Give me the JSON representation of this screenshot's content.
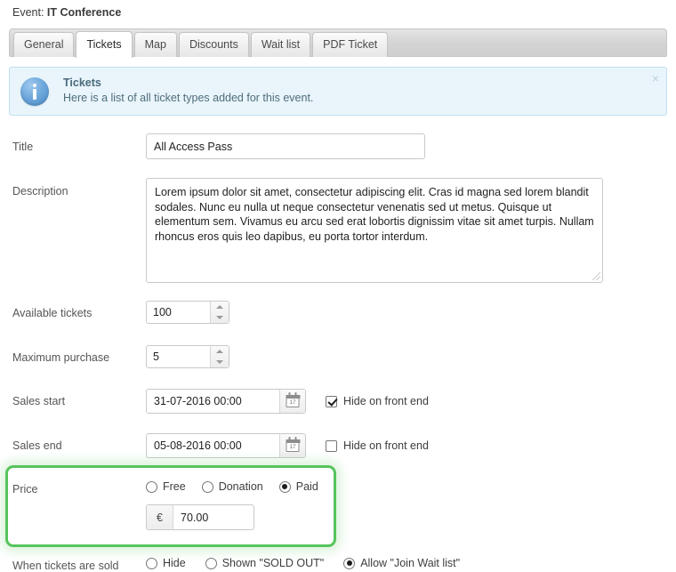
{
  "header": {
    "event_prefix": "Event:",
    "event_name": "IT Conference"
  },
  "tabs": [
    {
      "label": "General",
      "active": false
    },
    {
      "label": "Tickets",
      "active": true
    },
    {
      "label": "Map",
      "active": false
    },
    {
      "label": "Discounts",
      "active": false
    },
    {
      "label": "Wait list",
      "active": false
    },
    {
      "label": "PDF Ticket",
      "active": false
    }
  ],
  "info": {
    "icon": "info-circle-icon",
    "title": "Tickets",
    "text": "Here is a list of all ticket types added for this event.",
    "close_label": "×"
  },
  "form": {
    "title": {
      "label": "Title",
      "value": "All Access Pass",
      "placeholder": ""
    },
    "description": {
      "label": "Description",
      "value": "Lorem ipsum dolor sit amet, consectetur adipiscing elit. Cras id magna sed lorem blandit sodales. Nunc eu nulla ut neque consectetur venenatis sed ut metus. Quisque ut elementum sem. Vivamus eu arcu sed erat lobortis dignissim vitae sit amet turpis. Nullam rhoncus eros quis leo dapibus, eu porta tortor interdum.",
      "placeholder": ""
    },
    "available_tickets": {
      "label": "Available tickets",
      "value": "100"
    },
    "maximum_purchase": {
      "label": "Maximum purchase",
      "value": "5"
    },
    "sales_start": {
      "label": "Sales start",
      "value": "31-07-2016 00:00",
      "calendar_day": "17",
      "hide_label": "Hide on front end",
      "hide_checked": true
    },
    "sales_end": {
      "label": "Sales end",
      "value": "05-08-2016 00:00",
      "calendar_day": "17",
      "hide_label": "Hide on front end",
      "hide_checked": false
    },
    "price": {
      "label": "Price",
      "options": [
        {
          "label": "Free",
          "selected": false
        },
        {
          "label": "Donation",
          "selected": false
        },
        {
          "label": "Paid",
          "selected": true
        }
      ],
      "currency_symbol": "€",
      "amount": "70.00",
      "highlight_color": "#56c45c"
    },
    "when_sold": {
      "label": "When tickets are sold",
      "options": [
        {
          "label": "Hide",
          "selected": false
        },
        {
          "label": "Shown \"SOLD OUT\"",
          "selected": false
        },
        {
          "label": "Allow \"Join Wait list\"",
          "selected": true
        }
      ]
    }
  }
}
